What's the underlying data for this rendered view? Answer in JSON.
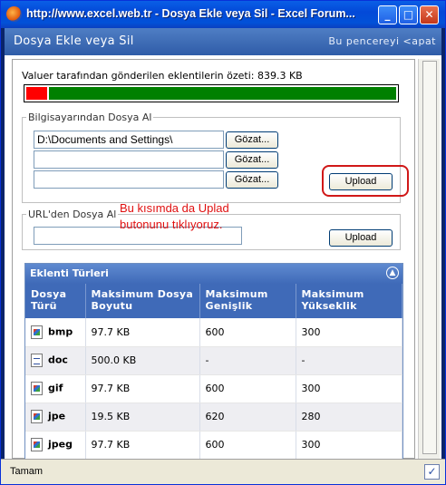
{
  "window": {
    "title": "http://www.excel.web.tr - Dosya Ekle veya Sil - Excel Forum..."
  },
  "header": {
    "title": "Dosya Ekle veya Sil",
    "close_label": "Bu pencereyi <apat"
  },
  "summary": {
    "text": "Valuer tarafından gönderilen eklentilerin özeti: 839.3 KB",
    "used_fraction": 0.057
  },
  "computer_group": {
    "legend": "Bilgisayarından Dosya Al",
    "inputs": [
      "D:\\Documents and Settings\\",
      "",
      ""
    ],
    "browse_label": "Gözat...",
    "upload_label": "Upload"
  },
  "url_group": {
    "legend": "URL'den Dosya Al",
    "value": "",
    "upload_label": "Upload"
  },
  "annotation": {
    "line1": "Bu kısımda da Uplad",
    "line2": "butonunu tıklıyoruz."
  },
  "panel": {
    "title": "Eklenti Türleri",
    "columns": [
      "Dosya Türü",
      "Maksimum Dosya Boyutu",
      "Maksimum Genişlik",
      "Maksimum Yükseklik"
    ],
    "rows": [
      {
        "ext": "bmp",
        "icon": "image-file-icon",
        "size": "97.7 KB",
        "width": "600",
        "height": "300"
      },
      {
        "ext": "doc",
        "icon": "word-file-icon",
        "size": "500.0 KB",
        "width": "-",
        "height": "-"
      },
      {
        "ext": "gif",
        "icon": "image-file-icon",
        "size": "97.7 KB",
        "width": "600",
        "height": "300"
      },
      {
        "ext": "jpe",
        "icon": "image-file-icon",
        "size": "19.5 KB",
        "width": "620",
        "height": "280"
      },
      {
        "ext": "jpeg",
        "icon": "image-file-icon",
        "size": "97.7 KB",
        "width": "600",
        "height": "300"
      }
    ]
  },
  "status": {
    "text": "Tamam"
  },
  "colors": {
    "used": "#ff0000",
    "free": "#008000",
    "annotation": "#e01010"
  }
}
